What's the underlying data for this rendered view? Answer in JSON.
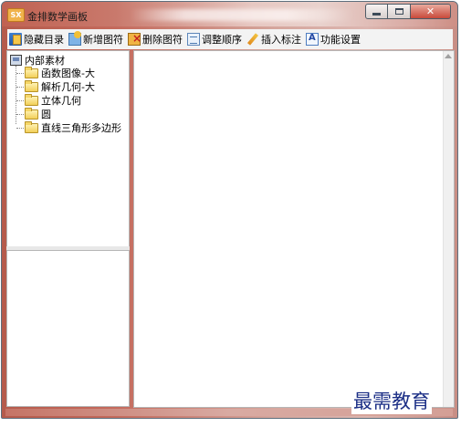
{
  "window": {
    "app_icon_text": "SX",
    "title": "金排数学画板"
  },
  "toolbar": {
    "buttons": [
      {
        "label": "隐藏目录",
        "icon": "hide-directory-icon"
      },
      {
        "label": "新增图符",
        "icon": "add-symbol-icon"
      },
      {
        "label": "删除图符",
        "icon": "delete-symbol-icon"
      },
      {
        "label": "调整顺序",
        "icon": "adjust-order-icon"
      },
      {
        "label": "插入标注",
        "icon": "pencil-icon"
      },
      {
        "label": "功能设置",
        "icon": "function-settings-icon"
      }
    ]
  },
  "tree": {
    "root": "内部素材",
    "items": [
      {
        "label": "函数图像-大"
      },
      {
        "label": "解析几何-大"
      },
      {
        "label": "立体几何"
      },
      {
        "label": "圆"
      },
      {
        "label": "直线三角形多边形"
      }
    ]
  },
  "watermark": "最需教育",
  "colors": {
    "titlebar_accent": "#c06252",
    "close_button": "#c8493a",
    "watermark": "#1c2f86"
  }
}
